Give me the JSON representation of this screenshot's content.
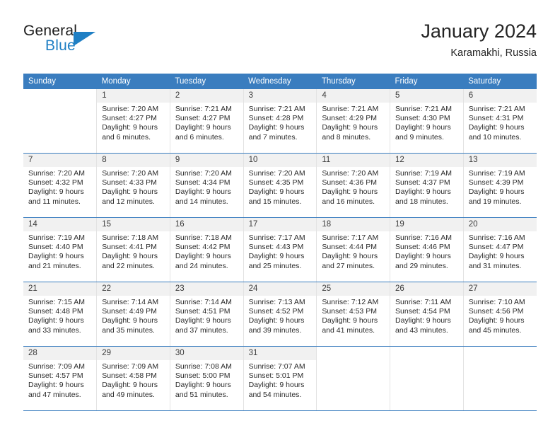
{
  "brand": {
    "name_part1": "General",
    "name_part2": "Blue",
    "triangle_icon": "brand-triangle-icon",
    "accent_color": "#1f7fc4"
  },
  "header": {
    "title": "January 2024",
    "subtitle": "Karamakhi, Russia"
  },
  "theme": {
    "header_row_bg": "#3a7dbf",
    "daynum_bg": "#f1f1f1",
    "text_color": "#2b2b2b"
  },
  "weekdays": [
    "Sunday",
    "Monday",
    "Tuesday",
    "Wednesday",
    "Thursday",
    "Friday",
    "Saturday"
  ],
  "weeks": [
    [
      {
        "empty": true
      },
      {
        "day": "1",
        "sunrise": "Sunrise: 7:20 AM",
        "sunset": "Sunset: 4:27 PM",
        "daylight1": "Daylight: 9 hours",
        "daylight2": "and 6 minutes."
      },
      {
        "day": "2",
        "sunrise": "Sunrise: 7:21 AM",
        "sunset": "Sunset: 4:27 PM",
        "daylight1": "Daylight: 9 hours",
        "daylight2": "and 6 minutes."
      },
      {
        "day": "3",
        "sunrise": "Sunrise: 7:21 AM",
        "sunset": "Sunset: 4:28 PM",
        "daylight1": "Daylight: 9 hours",
        "daylight2": "and 7 minutes."
      },
      {
        "day": "4",
        "sunrise": "Sunrise: 7:21 AM",
        "sunset": "Sunset: 4:29 PM",
        "daylight1": "Daylight: 9 hours",
        "daylight2": "and 8 minutes."
      },
      {
        "day": "5",
        "sunrise": "Sunrise: 7:21 AM",
        "sunset": "Sunset: 4:30 PM",
        "daylight1": "Daylight: 9 hours",
        "daylight2": "and 9 minutes."
      },
      {
        "day": "6",
        "sunrise": "Sunrise: 7:21 AM",
        "sunset": "Sunset: 4:31 PM",
        "daylight1": "Daylight: 9 hours",
        "daylight2": "and 10 minutes."
      }
    ],
    [
      {
        "day": "7",
        "sunrise": "Sunrise: 7:20 AM",
        "sunset": "Sunset: 4:32 PM",
        "daylight1": "Daylight: 9 hours",
        "daylight2": "and 11 minutes."
      },
      {
        "day": "8",
        "sunrise": "Sunrise: 7:20 AM",
        "sunset": "Sunset: 4:33 PM",
        "daylight1": "Daylight: 9 hours",
        "daylight2": "and 12 minutes."
      },
      {
        "day": "9",
        "sunrise": "Sunrise: 7:20 AM",
        "sunset": "Sunset: 4:34 PM",
        "daylight1": "Daylight: 9 hours",
        "daylight2": "and 14 minutes."
      },
      {
        "day": "10",
        "sunrise": "Sunrise: 7:20 AM",
        "sunset": "Sunset: 4:35 PM",
        "daylight1": "Daylight: 9 hours",
        "daylight2": "and 15 minutes."
      },
      {
        "day": "11",
        "sunrise": "Sunrise: 7:20 AM",
        "sunset": "Sunset: 4:36 PM",
        "daylight1": "Daylight: 9 hours",
        "daylight2": "and 16 minutes."
      },
      {
        "day": "12",
        "sunrise": "Sunrise: 7:19 AM",
        "sunset": "Sunset: 4:37 PM",
        "daylight1": "Daylight: 9 hours",
        "daylight2": "and 18 minutes."
      },
      {
        "day": "13",
        "sunrise": "Sunrise: 7:19 AM",
        "sunset": "Sunset: 4:39 PM",
        "daylight1": "Daylight: 9 hours",
        "daylight2": "and 19 minutes."
      }
    ],
    [
      {
        "day": "14",
        "sunrise": "Sunrise: 7:19 AM",
        "sunset": "Sunset: 4:40 PM",
        "daylight1": "Daylight: 9 hours",
        "daylight2": "and 21 minutes."
      },
      {
        "day": "15",
        "sunrise": "Sunrise: 7:18 AM",
        "sunset": "Sunset: 4:41 PM",
        "daylight1": "Daylight: 9 hours",
        "daylight2": "and 22 minutes."
      },
      {
        "day": "16",
        "sunrise": "Sunrise: 7:18 AM",
        "sunset": "Sunset: 4:42 PM",
        "daylight1": "Daylight: 9 hours",
        "daylight2": "and 24 minutes."
      },
      {
        "day": "17",
        "sunrise": "Sunrise: 7:17 AM",
        "sunset": "Sunset: 4:43 PM",
        "daylight1": "Daylight: 9 hours",
        "daylight2": "and 25 minutes."
      },
      {
        "day": "18",
        "sunrise": "Sunrise: 7:17 AM",
        "sunset": "Sunset: 4:44 PM",
        "daylight1": "Daylight: 9 hours",
        "daylight2": "and 27 minutes."
      },
      {
        "day": "19",
        "sunrise": "Sunrise: 7:16 AM",
        "sunset": "Sunset: 4:46 PM",
        "daylight1": "Daylight: 9 hours",
        "daylight2": "and 29 minutes."
      },
      {
        "day": "20",
        "sunrise": "Sunrise: 7:16 AM",
        "sunset": "Sunset: 4:47 PM",
        "daylight1": "Daylight: 9 hours",
        "daylight2": "and 31 minutes."
      }
    ],
    [
      {
        "day": "21",
        "sunrise": "Sunrise: 7:15 AM",
        "sunset": "Sunset: 4:48 PM",
        "daylight1": "Daylight: 9 hours",
        "daylight2": "and 33 minutes."
      },
      {
        "day": "22",
        "sunrise": "Sunrise: 7:14 AM",
        "sunset": "Sunset: 4:49 PM",
        "daylight1": "Daylight: 9 hours",
        "daylight2": "and 35 minutes."
      },
      {
        "day": "23",
        "sunrise": "Sunrise: 7:14 AM",
        "sunset": "Sunset: 4:51 PM",
        "daylight1": "Daylight: 9 hours",
        "daylight2": "and 37 minutes."
      },
      {
        "day": "24",
        "sunrise": "Sunrise: 7:13 AM",
        "sunset": "Sunset: 4:52 PM",
        "daylight1": "Daylight: 9 hours",
        "daylight2": "and 39 minutes."
      },
      {
        "day": "25",
        "sunrise": "Sunrise: 7:12 AM",
        "sunset": "Sunset: 4:53 PM",
        "daylight1": "Daylight: 9 hours",
        "daylight2": "and 41 minutes."
      },
      {
        "day": "26",
        "sunrise": "Sunrise: 7:11 AM",
        "sunset": "Sunset: 4:54 PM",
        "daylight1": "Daylight: 9 hours",
        "daylight2": "and 43 minutes."
      },
      {
        "day": "27",
        "sunrise": "Sunrise: 7:10 AM",
        "sunset": "Sunset: 4:56 PM",
        "daylight1": "Daylight: 9 hours",
        "daylight2": "and 45 minutes."
      }
    ],
    [
      {
        "day": "28",
        "sunrise": "Sunrise: 7:09 AM",
        "sunset": "Sunset: 4:57 PM",
        "daylight1": "Daylight: 9 hours",
        "daylight2": "and 47 minutes."
      },
      {
        "day": "29",
        "sunrise": "Sunrise: 7:09 AM",
        "sunset": "Sunset: 4:58 PM",
        "daylight1": "Daylight: 9 hours",
        "daylight2": "and 49 minutes."
      },
      {
        "day": "30",
        "sunrise": "Sunrise: 7:08 AM",
        "sunset": "Sunset: 5:00 PM",
        "daylight1": "Daylight: 9 hours",
        "daylight2": "and 51 minutes."
      },
      {
        "day": "31",
        "sunrise": "Sunrise: 7:07 AM",
        "sunset": "Sunset: 5:01 PM",
        "daylight1": "Daylight: 9 hours",
        "daylight2": "and 54 minutes."
      },
      {
        "empty": true
      },
      {
        "empty": true
      },
      {
        "empty": true
      }
    ]
  ]
}
